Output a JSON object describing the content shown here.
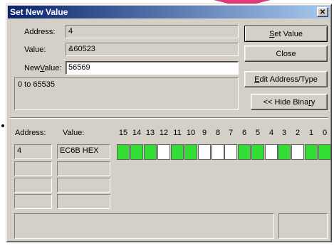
{
  "window": {
    "title": "Set New Value",
    "close_glyph": "✕"
  },
  "colors": {
    "title_bg": "#0a246a",
    "bit_on": "#33dd33",
    "bit_off": "#ffffff",
    "accent_triangle": "#e0387a"
  },
  "top": {
    "address_label": "Address:",
    "address_value": "4",
    "value_label": "Value:",
    "value_value": "&60523",
    "new_value_label_pre": "New",
    "new_value_label_u": "V",
    "new_value_label_post": "alue:",
    "new_value_value": "56569",
    "range_text": "0 to 65535"
  },
  "buttons": {
    "set_value_u": "S",
    "set_value_rest": "et Value",
    "close": "Close",
    "edit_u": "E",
    "edit_rest": "dit Address/Type",
    "hide_binary_pre": "<< Hide Bina",
    "hide_binary_u": "r",
    "hide_binary_post": "y"
  },
  "binary": {
    "address_header": "Address:",
    "value_header": "Value:",
    "row_address": "4",
    "row_value": "EC6B HEX",
    "bit_labels": [
      "15",
      "14",
      "13",
      "12",
      "11",
      "10",
      "9",
      "8",
      "7",
      "6",
      "5",
      "4",
      "3",
      "2",
      "1",
      "0"
    ],
    "bits": [
      1,
      1,
      1,
      0,
      1,
      1,
      0,
      0,
      0,
      1,
      1,
      0,
      1,
      0,
      1,
      1
    ]
  }
}
